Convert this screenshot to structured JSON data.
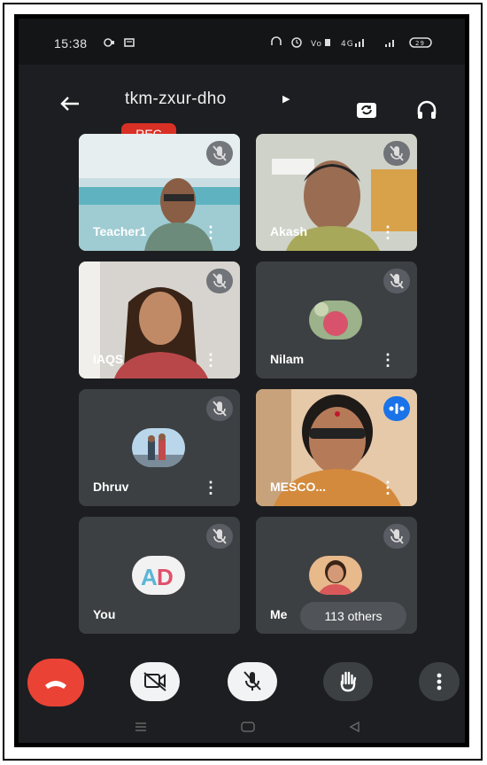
{
  "status_bar": {
    "time": "15:38",
    "right_icons": "∩ ⏰ • ▕▕ ▌"
  },
  "header": {
    "meeting_code": "tkm-zxur-dho",
    "rec_label": "REC"
  },
  "participants": [
    {
      "name": "Teacher1",
      "type": "video"
    },
    {
      "name": "Akash",
      "type": "video"
    },
    {
      "name": "IAQS",
      "type": "video"
    },
    {
      "name": "Nilam",
      "type": "avatar"
    },
    {
      "name": "Dhruv",
      "type": "avatar"
    },
    {
      "name": "MESCO...",
      "type": "video",
      "speaking": true
    },
    {
      "name": "You",
      "type": "avatar"
    },
    {
      "name": "Me",
      "type": "avatar",
      "others_label": "113 others"
    }
  ],
  "colors": {
    "background": "#1d1e21",
    "tile": "#3c4043",
    "rec": "#d93025",
    "end_call": "#ea4335",
    "speaking": "#1a73e8"
  },
  "icons": {
    "back": "arrow-left",
    "switch_camera": "switch-camera",
    "audio_output": "headphones",
    "end_call": "phone-hangup",
    "camera_off": "video-off",
    "mic_off": "mic-off",
    "raise_hand": "hand",
    "more": "more-vertical"
  }
}
